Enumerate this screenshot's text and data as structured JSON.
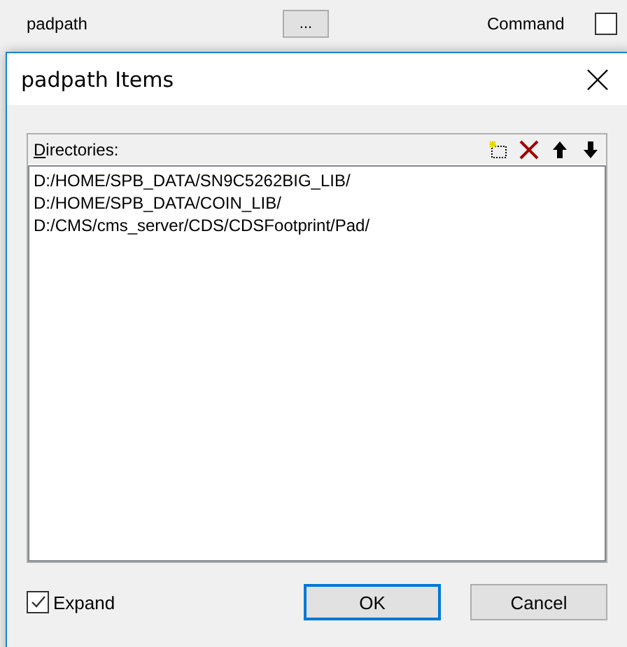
{
  "background_rows": [
    {
      "name": "padpath",
      "button": "...",
      "type": "Command",
      "checked": false
    }
  ],
  "dialog": {
    "title": "padpath Items",
    "list": {
      "label": "Directories:",
      "items": [
        "D:/HOME/SPB_DATA/SN9C5262BIG_LIB/",
        "D:/HOME/SPB_DATA/COIN_LIB/",
        "D:/CMS/cms_server/CDS/CDSFootprint/Pad/"
      ]
    },
    "expand": {
      "label": "Expand",
      "checked": true
    },
    "buttons": [
      {
        "label": "OK",
        "default": true
      },
      {
        "label": "Cancel",
        "default": false
      }
    ]
  }
}
